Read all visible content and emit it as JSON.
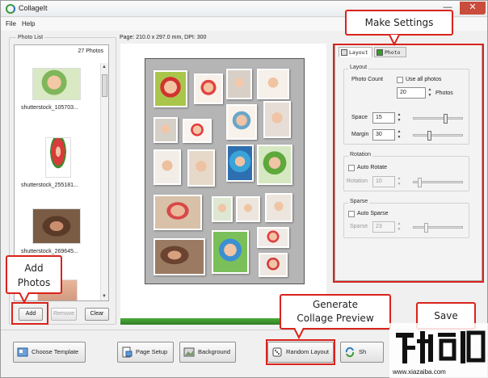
{
  "window": {
    "title": "CollageIt",
    "minimize_icon": "minimize-icon",
    "close_icon": "close-icon",
    "close_glyph": "✕",
    "minimize_glyph": "—"
  },
  "menu": {
    "items": [
      "File",
      "Help"
    ]
  },
  "photo_list": {
    "group_label": "Photo List",
    "count": "27 Photos",
    "items": [
      {
        "name": "shutterstock_105703..."
      },
      {
        "name": "shutterstock_255181..."
      },
      {
        "name": "shutterstock_269645..."
      }
    ],
    "buttons": {
      "add": "Add",
      "remove": "Remove",
      "clear": "Clear"
    }
  },
  "preview": {
    "page_info": "Page: 210.0 x 297.0 mm, DPI: 300"
  },
  "settings": {
    "tabs": {
      "layout": "Layout",
      "photo": "Photo"
    },
    "layout": {
      "group": "Layout",
      "photo_count_label": "Photo Count",
      "use_all_label": "Use all photos",
      "photo_count_value": "20",
      "photos_suffix": "Photos",
      "space_label": "Space",
      "space_value": "15",
      "margin_label": "Margin",
      "margin_value": "30"
    },
    "rotation": {
      "group": "Rotation",
      "auto_label": "Auto Rotate",
      "label": "Rotation",
      "value": "10"
    },
    "sparse": {
      "group": "Sparse",
      "auto_label": "Auto Sparse",
      "label": "Sparse",
      "value": "23"
    }
  },
  "toolbar": {
    "choose_template": "Choose Template",
    "page_setup": "Page Setup",
    "background": "Background",
    "random_layout": "Random Layout",
    "share": "Sh"
  },
  "callouts": {
    "make_settings": "Make Settings",
    "add_photos_1": "Add",
    "add_photos_2": "Photos",
    "generate_1": "Generate",
    "generate_2": "Collage Preview",
    "save": "Save"
  },
  "watermark": {
    "site": "www.xiazaiba.com"
  },
  "colors": {
    "accent_red": "#d9231c",
    "progress_green": "#3c9a32"
  }
}
